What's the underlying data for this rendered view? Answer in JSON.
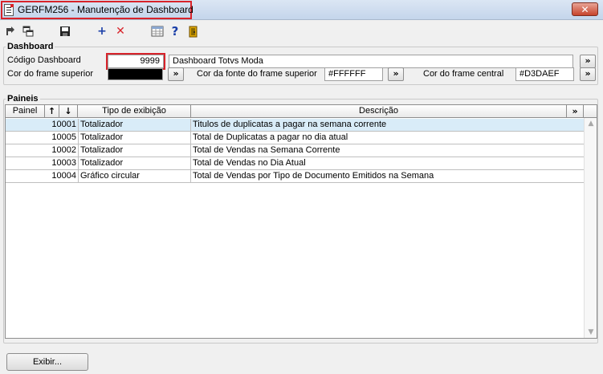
{
  "window": {
    "title": "GERFM256 - Manutenção de Dashboard",
    "close_label": "✕"
  },
  "toolbar": {
    "items": [
      {
        "icon": "back-arrow-icon"
      },
      {
        "icon": "windows-icon"
      },
      {
        "icon": "save-icon"
      },
      {
        "icon": "add-icon",
        "label": "+"
      },
      {
        "icon": "delete-icon",
        "label": "✕"
      },
      {
        "icon": "grid-icon"
      },
      {
        "icon": "help-icon",
        "label": "?"
      },
      {
        "icon": "exit-icon"
      }
    ]
  },
  "dashboard": {
    "group_label": "Dashboard",
    "codigo_label": "Código Dashboard",
    "codigo_value": "9999",
    "descricao_value": "Dashboard Totvs Moda",
    "cor_frame_superior_label": "Cor do frame superior",
    "cor_frame_superior_color": "#000000",
    "cor_fonte_label": "Cor da fonte do frame superior",
    "cor_fonte_value": "#FFFFFF",
    "cor_frame_central_label": "Cor do frame central",
    "cor_frame_central_value": "#D3DAEF",
    "more_label": "»"
  },
  "paineis": {
    "group_label": "Paineis",
    "columns": {
      "painel": "Painel",
      "up": "↑",
      "down": "↓",
      "tipo": "Tipo de exibição",
      "descricao": "Descrição",
      "more": "»"
    },
    "rows": [
      {
        "painel": "10001",
        "tipo": "Totalizador",
        "descricao": "Titulos de duplicatas a pagar na semana corrente"
      },
      {
        "painel": "10005",
        "tipo": "Totalizador",
        "descricao": "Total de Duplicatas a pagar no dia atual"
      },
      {
        "painel": "10002",
        "tipo": "Totalizador",
        "descricao": "Total de Vendas na Semana Corrente"
      },
      {
        "painel": "10003",
        "tipo": "Totalizador",
        "descricao": "Total de Vendas no Dia Atual"
      },
      {
        "painel": "10004",
        "tipo": "Gráfico circular",
        "descricao": "Total de Vendas por Tipo de Documento Emitidos na Semana"
      }
    ]
  },
  "footer": {
    "exibir_label": "Exibir..."
  }
}
